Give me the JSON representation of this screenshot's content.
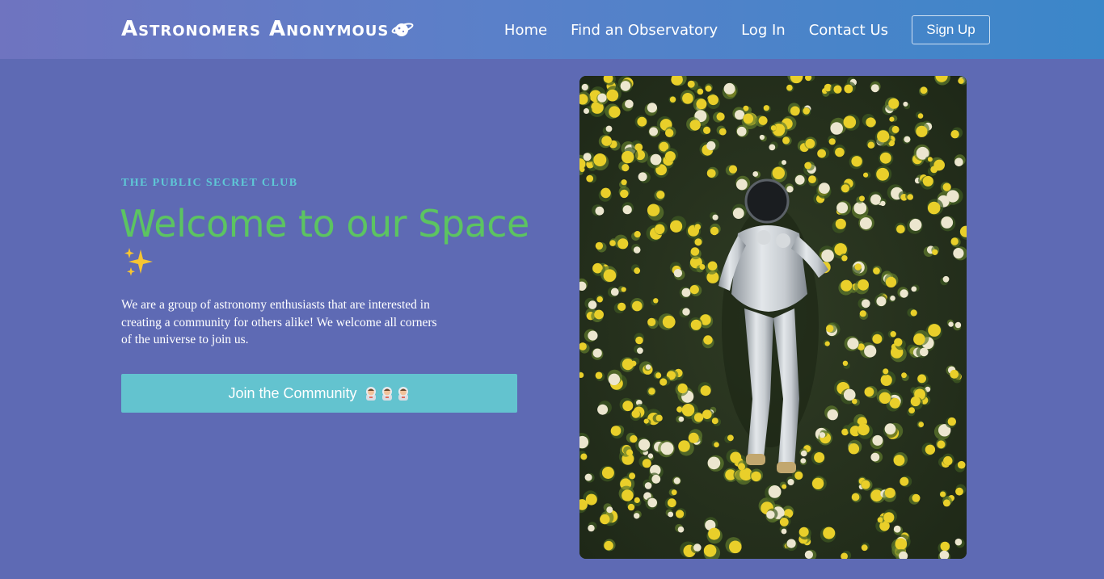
{
  "header": {
    "logo_text": "Astronomers Anonymous",
    "logo_icon": "planet-icon",
    "nav": [
      {
        "label": "Home"
      },
      {
        "label": "Find an Observatory"
      },
      {
        "label": "Log In"
      },
      {
        "label": "Contact Us"
      }
    ],
    "signup_label": "Sign Up"
  },
  "hero": {
    "eyebrow": "The Public Secret Club",
    "title": "Welcome to our Space",
    "title_icon": "sparkles-icon",
    "description": "We are a group of astronomy enthusiasts that are interested in creating a community for others alike! We welcome all corners of the universe to join us.",
    "cta_label": "Join the Community",
    "cta_icons": [
      "astronaut-icon",
      "astronaut-icon",
      "astronaut-icon"
    ],
    "photo_subject": "astronaut-in-flower-field"
  },
  "colors": {
    "background": "#5e6ab4",
    "header_start": "#6f74c0",
    "header_end": "#3b87c9",
    "eyebrow": "#5ec8d6",
    "title": "#5cc461",
    "cta": "#63c3cf"
  }
}
